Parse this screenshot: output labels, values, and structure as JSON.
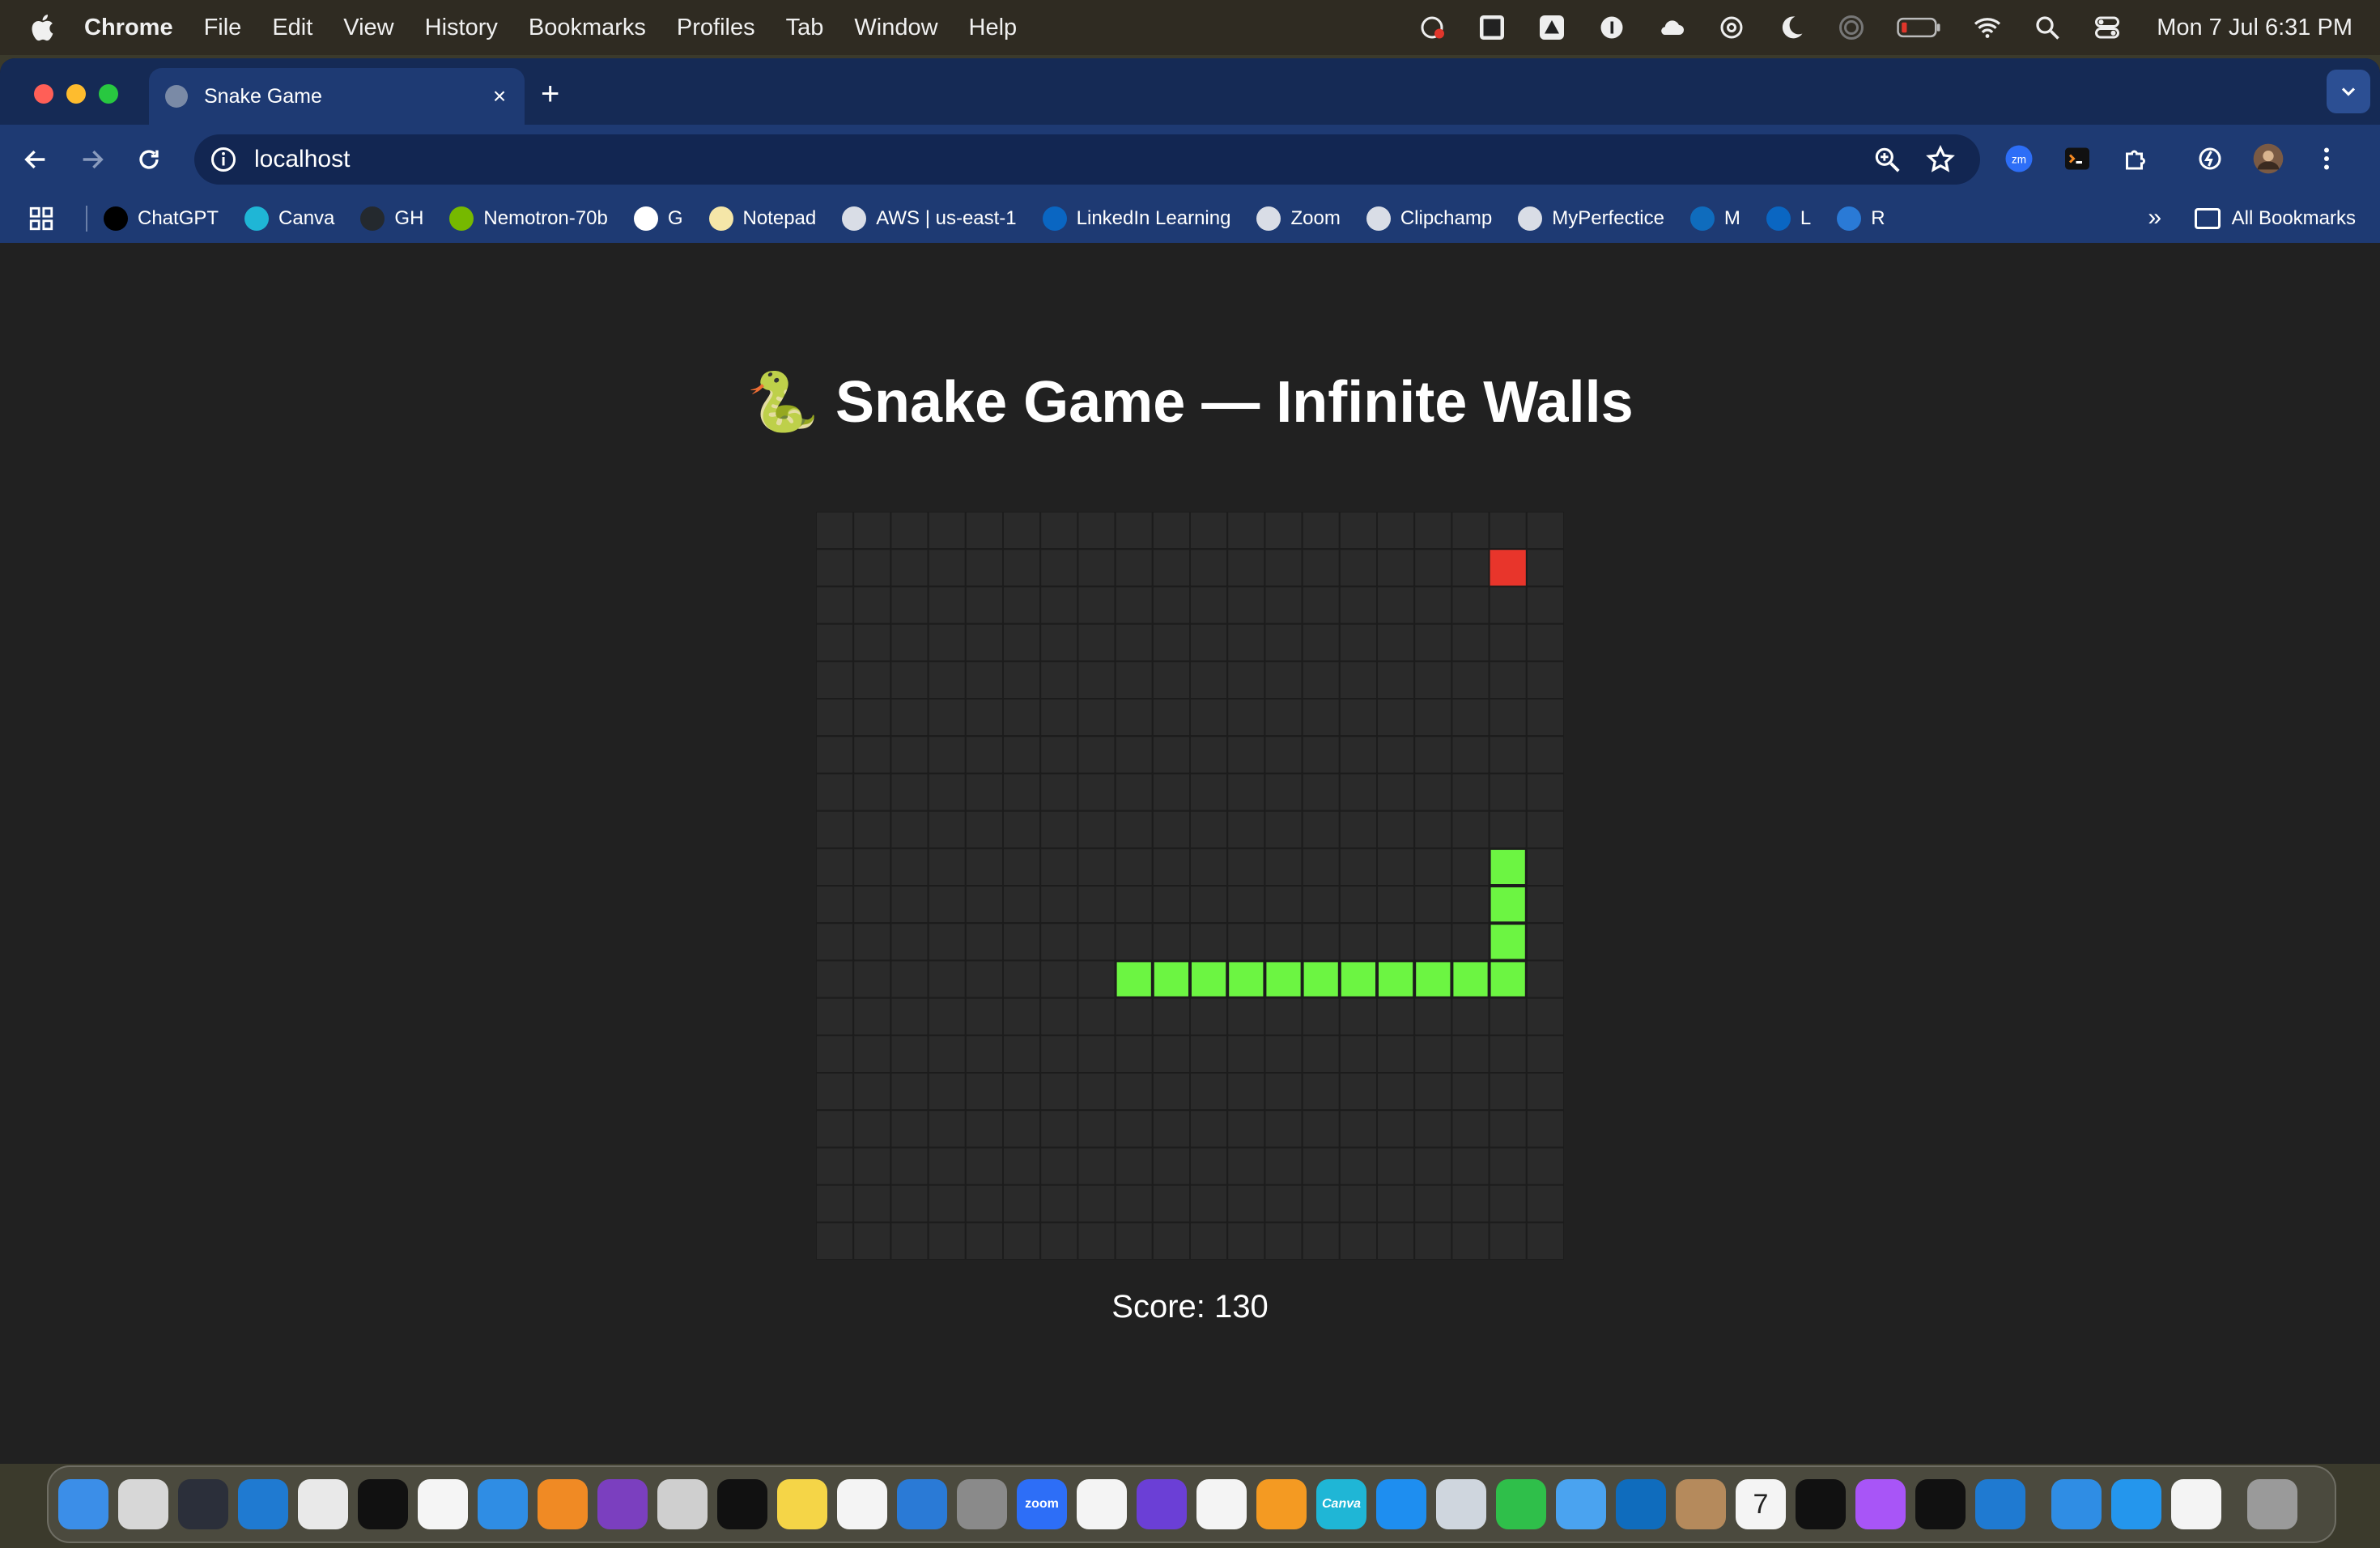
{
  "menubar": {
    "apple_icon": "apple-icon",
    "app_name": "Chrome",
    "items": [
      "File",
      "Edit",
      "View",
      "History",
      "Bookmarks",
      "Profiles",
      "Tab",
      "Window",
      "Help"
    ],
    "clock": "Mon 7 Jul  6:31 PM",
    "status_icons": [
      "creative-cloud-icon",
      "xp-pen-icon",
      "drive-icon",
      "one-password-icon",
      "cloud-icon",
      "chatgpt-icon",
      "moon-icon",
      "airdrop-icon",
      "battery-icon",
      "wifi-icon",
      "spotlight-icon",
      "control-center-icon"
    ]
  },
  "browser": {
    "tab_title": "Snake Game",
    "url": "localhost",
    "bookmarks": [
      {
        "label": "ChatGPT",
        "icon": "chatgpt-icon",
        "color": "#000000"
      },
      {
        "label": "Canva",
        "icon": "canva-icon",
        "color": "#1fb6d6"
      },
      {
        "label": "GH",
        "icon": "github-icon",
        "color": "#24292e"
      },
      {
        "label": "Nemotron-70b",
        "icon": "nvidia-icon",
        "color": "#76b900"
      },
      {
        "label": "G",
        "icon": "google-icon",
        "color": "#ffffff"
      },
      {
        "label": "Notepad",
        "icon": "notepad-icon",
        "color": "#f5e6a8"
      },
      {
        "label": "AWS | us-east-1",
        "icon": "globe-icon",
        "color": "#d9dde6"
      },
      {
        "label": "LinkedIn Learning",
        "icon": "linkedin-learning-icon",
        "color": "#0a66c2"
      },
      {
        "label": "Zoom",
        "icon": "globe-icon",
        "color": "#d9dde6"
      },
      {
        "label": "Clipchamp",
        "icon": "globe-icon",
        "color": "#d9dde6"
      },
      {
        "label": "MyPerfectice",
        "icon": "globe-icon",
        "color": "#d9dde6"
      },
      {
        "label": "M",
        "icon": "outlook-icon",
        "color": "#0f6cbd"
      },
      {
        "label": "L",
        "icon": "linkedin-icon",
        "color": "#0a66c2"
      },
      {
        "label": "R",
        "icon": "onedrive-icon",
        "color": "#2a7ad6"
      }
    ],
    "all_bookmarks": "All Bookmarks",
    "more_bookmarks": "»"
  },
  "game": {
    "title": "🐍 Snake Game — Infinite Walls",
    "score_label": "Score: 130",
    "score": 130,
    "grid_size": 20,
    "food": {
      "col": 18,
      "row": 1
    },
    "snake": [
      {
        "col": 18,
        "row": 9
      },
      {
        "col": 18,
        "row": 10
      },
      {
        "col": 18,
        "row": 11
      },
      {
        "col": 18,
        "row": 12
      },
      {
        "col": 17,
        "row": 12
      },
      {
        "col": 16,
        "row": 12
      },
      {
        "col": 15,
        "row": 12
      },
      {
        "col": 14,
        "row": 12
      },
      {
        "col": 13,
        "row": 12
      },
      {
        "col": 12,
        "row": 12
      },
      {
        "col": 11,
        "row": 12
      },
      {
        "col": 10,
        "row": 12
      },
      {
        "col": 9,
        "row": 12
      },
      {
        "col": 8,
        "row": 12
      }
    ],
    "colors": {
      "snake": "#6cf542",
      "food": "#e8352b",
      "cell": "#2a2a2a",
      "grid_line": "#1c1c1c"
    }
  },
  "dock": {
    "apps": [
      {
        "name": "finder-icon",
        "color": "#3b8ee8"
      },
      {
        "name": "launchpad-icon",
        "color": "#d7d7d7"
      },
      {
        "name": "obs-icon",
        "color": "#2b2f3a"
      },
      {
        "name": "vscode-icon",
        "color": "#1f7ad1"
      },
      {
        "name": "chrome-icon",
        "color": "#e9e9e9"
      },
      {
        "name": "github-copilot-icon",
        "color": "#111111"
      },
      {
        "name": "chatgpt-icon",
        "color": "#f5f5f5"
      },
      {
        "name": "safari-icon",
        "color": "#2f8de4"
      },
      {
        "name": "sourcetree-icon",
        "color": "#f08a24"
      },
      {
        "name": "github-desktop-icon",
        "color": "#7b3fbf"
      },
      {
        "name": "screenshot-icon",
        "color": "#cfcfcf"
      },
      {
        "name": "terminal-icon",
        "color": "#111111"
      },
      {
        "name": "notes-icon",
        "color": "#f5d547"
      },
      {
        "name": "freeform-icon",
        "color": "#f4f4f4"
      },
      {
        "name": "onedrive-icon",
        "color": "#2a7ad6"
      },
      {
        "name": "system-settings-icon",
        "color": "#8a8a8a"
      },
      {
        "name": "zoom-icon",
        "color": "#2d6ef7"
      },
      {
        "name": "google-drive-icon",
        "color": "#f4f4f4"
      },
      {
        "name": "imovie-icon",
        "color": "#6b3fd6"
      },
      {
        "name": "reminders-icon",
        "color": "#f4f4f4"
      },
      {
        "name": "pages-icon",
        "color": "#f49a22"
      },
      {
        "name": "canva-icon",
        "color": "#1fb6d6"
      },
      {
        "name": "app-store-icon",
        "color": "#1e8ef0"
      },
      {
        "name": "preview-icon",
        "color": "#cfd6de"
      },
      {
        "name": "numbers-icon",
        "color": "#2fbf4a"
      },
      {
        "name": "mail-icon",
        "color": "#4aa3f0"
      },
      {
        "name": "outlook-icon",
        "color": "#0f6cbd"
      },
      {
        "name": "contacts-icon",
        "color": "#b58a5c"
      },
      {
        "name": "calendar-icon",
        "color": "#f4f4f4"
      },
      {
        "name": "xp-pen-icon",
        "color": "#111111"
      },
      {
        "name": "feedback-icon",
        "color": "#a855f7"
      },
      {
        "name": "xp-pen-2-icon",
        "color": "#111111"
      },
      {
        "name": "vscode-2-icon",
        "color": "#1f7ad1"
      },
      {
        "name": "xcode-icon",
        "color": "#2f8de4"
      },
      {
        "name": "docker-icon",
        "color": "#2496ed"
      },
      {
        "name": "textedit-icon",
        "color": "#f4f4f4"
      },
      {
        "name": "trash-icon",
        "color": "#9a9a9a"
      }
    ],
    "calendar_day": "7",
    "zoom_label": "zoom",
    "canva_label": "Canva"
  }
}
